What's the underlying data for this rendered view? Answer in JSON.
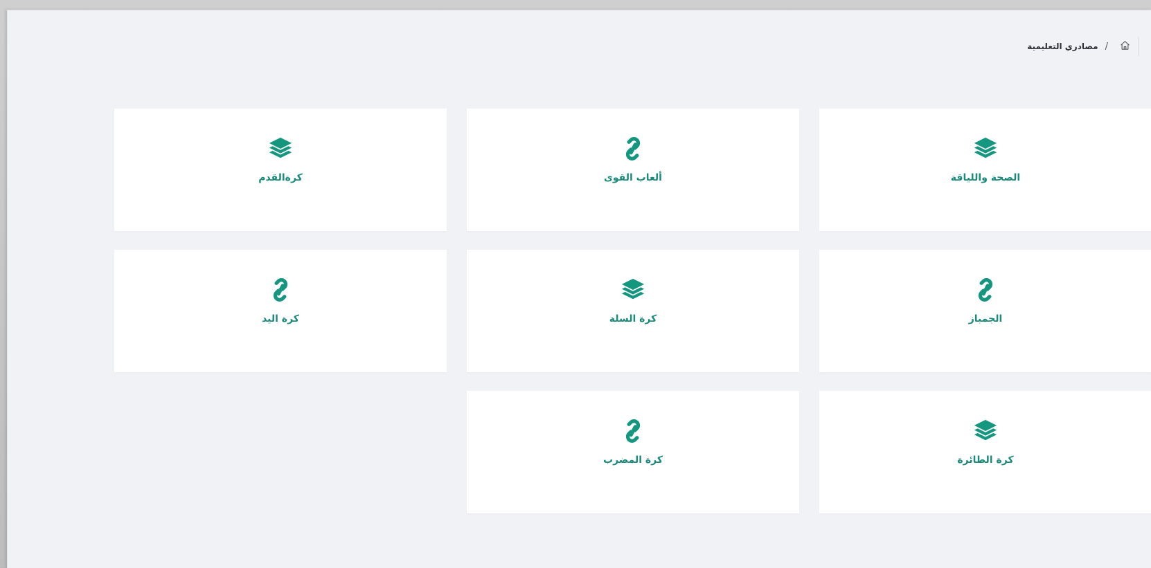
{
  "breadcrumb": {
    "home_icon": "home-icon",
    "separator": "/",
    "current": "مصادري التعليمية"
  },
  "colors": {
    "accent": "#14967f",
    "page_bg": "#f0f2f6",
    "card_bg": "#ffffff"
  },
  "cards": [
    {
      "label": "الصحة واللياقة",
      "icon": "layers-icon"
    },
    {
      "label": "ألعاب القوى",
      "icon": "link-icon"
    },
    {
      "label": "كرةالقدم",
      "icon": "layers-icon"
    },
    {
      "label": "الجمباز",
      "icon": "link-icon"
    },
    {
      "label": "كرة السلة",
      "icon": "layers-icon"
    },
    {
      "label": "كرة اليد",
      "icon": "link-icon"
    },
    {
      "label": "كرة الطائرة",
      "icon": "layers-icon"
    },
    {
      "label": "كرة المضرب",
      "icon": "link-icon"
    }
  ]
}
